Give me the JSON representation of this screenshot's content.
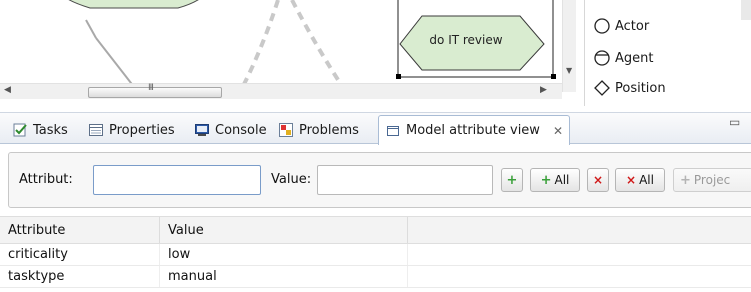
{
  "canvas": {
    "shape_label": "do IT review"
  },
  "palette": {
    "items": [
      {
        "label": "Actor",
        "icon": "actor-circle-icon"
      },
      {
        "label": "Agent",
        "icon": "agent-circle-icon"
      },
      {
        "label": "Position",
        "icon": "position-diamond-icon"
      }
    ]
  },
  "scrollbar": {
    "grip": "III"
  },
  "tabs": [
    {
      "label": "Tasks",
      "icon": "tasks-icon"
    },
    {
      "label": "Properties",
      "icon": "properties-icon"
    },
    {
      "label": "Console",
      "icon": "console-icon"
    },
    {
      "label": "Problems",
      "icon": "problems-icon"
    },
    {
      "label": "Model attribute view",
      "icon": "view-icon",
      "active": true
    }
  ],
  "attribute_form": {
    "attribute_label": "Attribut:",
    "attribute_value": "",
    "value_label": "Value:",
    "value_value": "",
    "add_label": "+",
    "add_all_label": "All",
    "remove_label": "×",
    "remove_all_label": "All",
    "project_label": "Projec"
  },
  "table": {
    "columns": [
      "Attribute",
      "Value",
      ""
    ],
    "rows": [
      {
        "attribute": "criticality",
        "value": "low"
      },
      {
        "attribute": "tasktype",
        "value": "manual"
      }
    ]
  },
  "colors": {
    "shape_fill": "#d9ecd0",
    "shape_stroke": "#3a3a3a",
    "tab_active_border": "#a9bcd5",
    "add_green": "#3aa03a",
    "remove_red": "#d01818"
  }
}
